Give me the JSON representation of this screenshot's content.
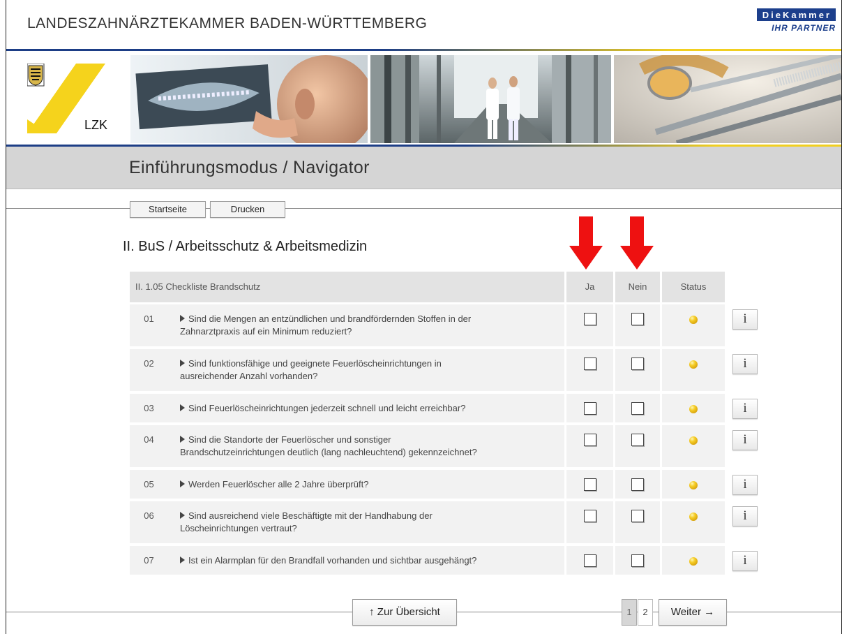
{
  "header": {
    "org_title": "LANDESZAHNÄRZTEKAMMER BADEN-WÜRTTEMBERG",
    "partner_logo_line1": "DieKammer",
    "partner_logo_line2": "IHR PARTNER",
    "lzk_logo_text": "LZK"
  },
  "titlebar": {
    "title": "Einführungsmodus / Navigator"
  },
  "nav": {
    "home_label": "Startseite",
    "print_label": "Drucken"
  },
  "section": {
    "title": "II. BuS / Arbeitsschutz & Arbeitsmedizin"
  },
  "table": {
    "header": {
      "title": "II. 1.05 Checkliste Brandschutz",
      "col_yes": "Ja",
      "col_no": "Nein",
      "col_status": "Status"
    },
    "info_label": "i",
    "rows": [
      {
        "num": "01",
        "line1": "Sind die Mengen an entzündlichen und brandfördernden Stoffen in der",
        "line2": "Zahnarztpraxis auf ein Minimum reduziert?"
      },
      {
        "num": "02",
        "line1": "Sind funktionsfähige und geeignete Feuerlöscheinrichtungen in",
        "line2": "ausreichender Anzahl vorhanden?"
      },
      {
        "num": "03",
        "line1": "Sind Feuerlöscheinrichtungen jederzeit schnell und leicht erreichbar?",
        "line2": ""
      },
      {
        "num": "04",
        "line1": "Sind die Standorte der Feuerlöscher und sonstiger",
        "line2": "Brandschutzeinrichtungen deutlich (lang nachleuchtend) gekennzeichnet?"
      },
      {
        "num": "05",
        "line1": "Werden Feuerlöscher alle 2 Jahre überprüft?",
        "line2": ""
      },
      {
        "num": "06",
        "line1": "Sind ausreichend viele Beschäftigte mit der Handhabung der",
        "line2": "Löscheinrichtungen vertraut?"
      },
      {
        "num": "07",
        "line1": "Ist ein Alarmplan für den Brandfall vorhanden und sichtbar ausgehängt?",
        "line2": ""
      }
    ]
  },
  "footer": {
    "overview_label": "↑ Zur Übersicht",
    "page1": "1",
    "page2": "2",
    "next_label": "Weiter →"
  },
  "colors": {
    "brand_blue": "#1d3e86",
    "brand_yellow": "#f1cf20",
    "arrow_red": "#ee1111",
    "status_dot": "#f5cc25"
  }
}
